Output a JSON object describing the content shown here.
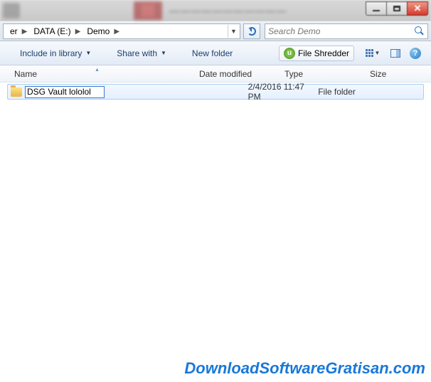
{
  "titlebar": {
    "background_hint": "blurred browser tab behind"
  },
  "window_controls": {
    "minimize": "minimize",
    "maximize": "maximize",
    "close": "close"
  },
  "breadcrumb": {
    "items": [
      {
        "label": "er"
      },
      {
        "label": "DATA (E:)"
      },
      {
        "label": "Demo"
      }
    ]
  },
  "search": {
    "placeholder": "Search Demo"
  },
  "toolbar": {
    "include_label": "Include in library",
    "share_label": "Share with",
    "newfolder_label": "New folder",
    "shredder_label": "File Shredder",
    "shredder_badge": "u"
  },
  "columns": {
    "name": "Name",
    "date": "Date modified",
    "type": "Type",
    "size": "Size",
    "sorted_by": "name",
    "sort_dir": "asc"
  },
  "files": [
    {
      "name_editing": true,
      "name_value": "DSG Vault lololol",
      "date": "2/4/2016 11:47 PM",
      "type": "File folder",
      "size": ""
    }
  ],
  "watermark": {
    "text": "DownloadSoftwareGratisan.com"
  },
  "colors": {
    "link_blue": "#1878d8",
    "selection_border": "#a8cff5",
    "toolbar_text": "#1a3d6d"
  }
}
